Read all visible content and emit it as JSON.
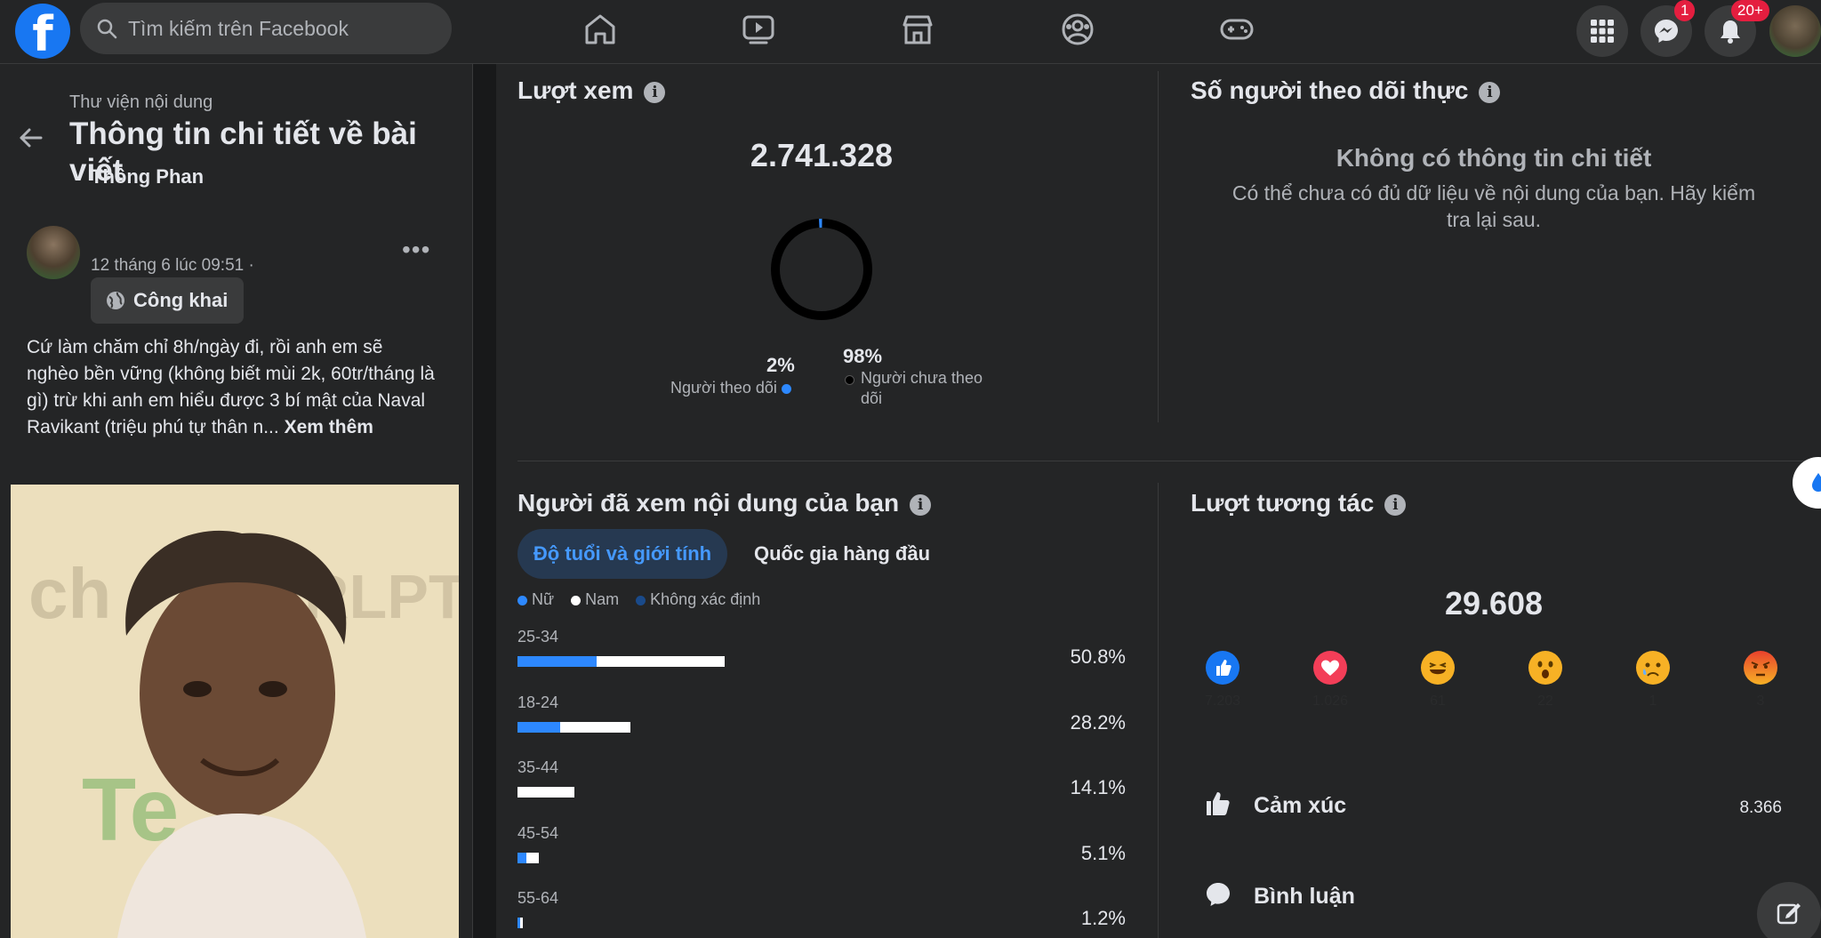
{
  "topbar": {
    "logo": "f",
    "search_placeholder": "Tìm kiếm trên Facebook",
    "nav_icons": [
      "home-icon",
      "watch-icon",
      "marketplace-icon",
      "groups-icon",
      "gaming-icon"
    ],
    "menu_icon": "grid-menu-icon",
    "messenger_badge": "1",
    "notifications_badge": "20+"
  },
  "left": {
    "breadcrumb": "Thư viện nội dung",
    "title": "Thông tin chi tiết về bài viết",
    "post": {
      "author": "Thông Phan",
      "date": "12 tháng 6 lúc 09:51 ·",
      "privacy": "Công khai",
      "text": "Cứ làm chăm chỉ 8h/ngày đi, rồi anh em sẽ nghèo bền vững (không biết mùi 2k, 60tr/tháng là gì) trừ khi anh em hiểu được 3 bí mật của Naval Ravikant (triệu phú tự thân n...",
      "see_more": "Xem thêm"
    }
  },
  "views": {
    "title": "Lượt xem",
    "total": "2.741.328",
    "followers_pct": "2%",
    "followers_label": "Người theo dõi",
    "non_followers_pct": "98%",
    "non_followers_label": "Người chưa theo dõi",
    "followers_fraction": 0.02,
    "colors": {
      "followers": "#2d88ff",
      "non_followers": "#000000"
    }
  },
  "live_followers": {
    "title": "Số người theo dõi thực",
    "empty_title": "Không có thông tin chi tiết",
    "empty_sub": "Có thể chưa có đủ dữ liệu về nội dung của bạn. Hãy kiểm tra lại sau."
  },
  "audience": {
    "title": "Người đã xem nội dung của bạn",
    "tab_active": "Độ tuổi và giới tính",
    "tab_other": "Quốc gia hàng đầu",
    "legend": [
      "Nữ",
      "Nam",
      "Không xác định"
    ],
    "legend_colors": [
      "#2d88ff",
      "#ffffff",
      "#1a4a8a"
    ],
    "rows": [
      {
        "age": "25-34",
        "pct": "50.8%",
        "female": 0.13,
        "male": 0.21
      },
      {
        "age": "18-24",
        "pct": "28.2%",
        "female": 0.07,
        "male": 0.115
      },
      {
        "age": "35-44",
        "pct": "14.1%",
        "female": 0.0,
        "male": 0.093
      },
      {
        "age": "45-54",
        "pct": "5.1%",
        "female": 0.014,
        "male": 0.02
      },
      {
        "age": "55-64",
        "pct": "1.2%",
        "female": 0.004,
        "male": 0.004
      }
    ]
  },
  "engagement": {
    "title": "Lượt tương tác",
    "total": "29.608",
    "reactions": [
      {
        "icon": "like-icon",
        "count": "7.203"
      },
      {
        "icon": "love-icon",
        "count": "1.026"
      },
      {
        "icon": "haha-icon",
        "count": "61"
      },
      {
        "icon": "wow-icon",
        "count": "22"
      },
      {
        "icon": "sad-icon",
        "count": "1"
      },
      {
        "icon": "angry-icon",
        "count": "3"
      }
    ],
    "metrics": [
      {
        "label": "Cảm xúc",
        "value": "8.366",
        "icon": "thumbs-up-icon"
      },
      {
        "label": "Bình luận",
        "value": "",
        "icon": "comment-icon"
      }
    ]
  }
}
